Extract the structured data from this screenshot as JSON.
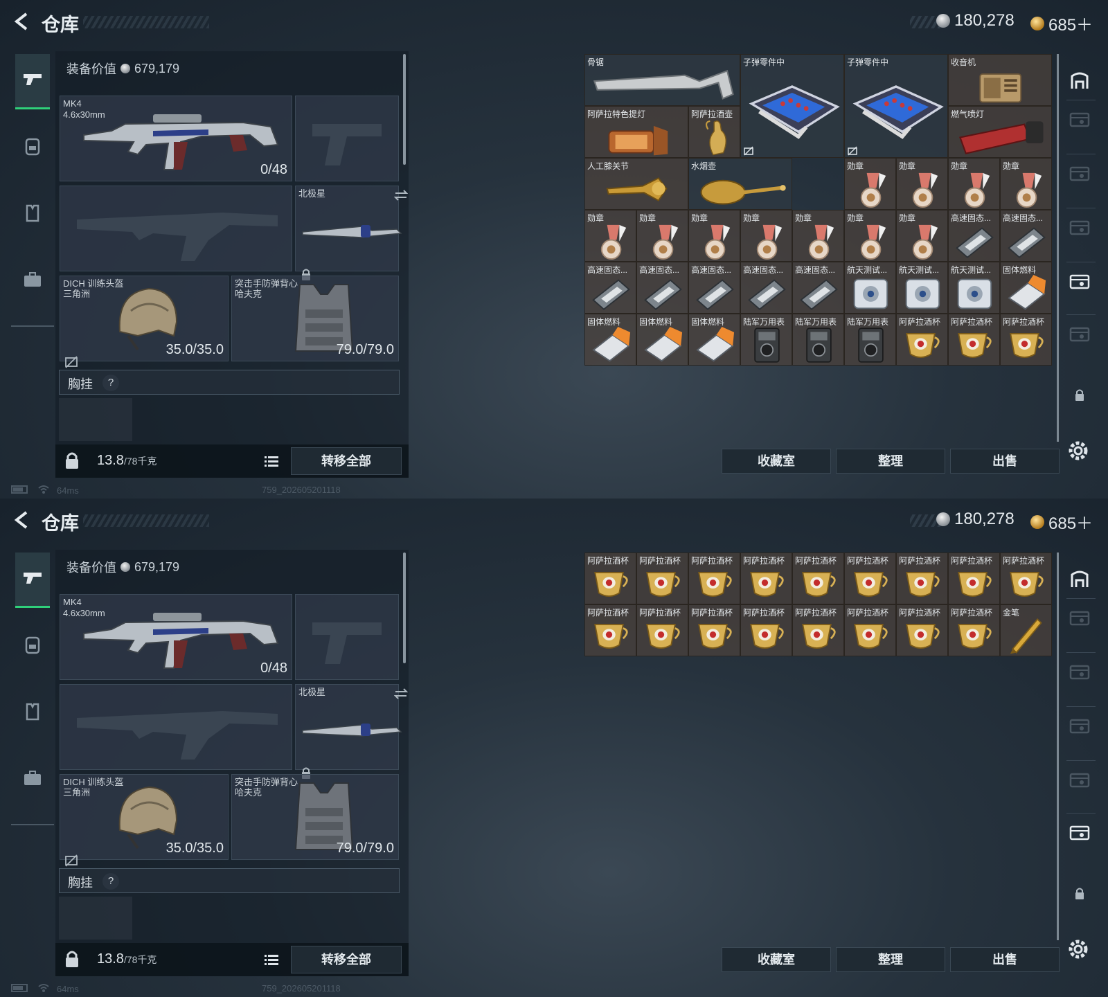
{
  "screens": [
    {
      "title": "仓库",
      "currency": {
        "silver": "180,278",
        "gold": "685＋"
      },
      "equip_value_label": "装备价值",
      "equip_value": "679,179",
      "weapon": {
        "name": "MK4",
        "ammo_type": "4.6x30mm",
        "ammo": "0/48"
      },
      "melee": {
        "name": "北极星"
      },
      "helmet": {
        "name": "DICH 训练头盔",
        "brand": "三角洲",
        "durability": "35.0/35.0"
      },
      "armor": {
        "name": "突击手防弹背心",
        "brand": "哈夫克",
        "durability": "79.0/79.0"
      },
      "chest_rig": {
        "label": "胸挂",
        "hint": "?"
      },
      "weight": {
        "current": "13.8",
        "max": "/78千克"
      },
      "transfer_all": "转移全部",
      "status": {
        "ping": "64ms",
        "build": "759_202605201118"
      },
      "actions": {
        "collection": "收藏室",
        "sort": "整理",
        "sell": "出售"
      },
      "stash": [
        {
          "label": "骨锯",
          "icon": "bone-saw-icon"
        },
        {
          "label": "子弹零件中",
          "icon": "ammo-parts-box-icon"
        },
        {
          "label": "子弹零件中",
          "icon": "ammo-parts-box-icon"
        },
        {
          "label": "收音机",
          "icon": "radio-icon"
        },
        {
          "label": "阿萨拉特色提灯",
          "icon": "lantern-icon"
        },
        {
          "label": "阿萨拉酒壶",
          "icon": "wine-pot-icon"
        },
        {
          "label": "燃气喷灯",
          "icon": "gas-torch-icon"
        },
        {
          "label": "人工膝关节",
          "icon": "knee-joint-icon"
        },
        {
          "label": "水烟壶",
          "icon": "hookah-icon"
        },
        {
          "label": "勋章",
          "icon": "medal-icon"
        },
        {
          "label": "勋章",
          "icon": "medal-icon"
        },
        {
          "label": "勋章",
          "icon": "medal-icon"
        },
        {
          "label": "勋章",
          "icon": "medal-icon"
        },
        {
          "label": "勋章",
          "icon": "medal-icon"
        },
        {
          "label": "勋章",
          "icon": "medal-icon"
        },
        {
          "label": "勋章",
          "icon": "medal-icon"
        },
        {
          "label": "勋章",
          "icon": "medal-icon"
        },
        {
          "label": "勋章",
          "icon": "medal-icon"
        },
        {
          "label": "勋章",
          "icon": "medal-icon"
        },
        {
          "label": "勋章",
          "icon": "medal-icon"
        },
        {
          "label": "高速固态...",
          "icon": "ssd-icon"
        },
        {
          "label": "高速固态...",
          "icon": "ssd-icon"
        },
        {
          "label": "高速固态...",
          "icon": "ssd-icon"
        },
        {
          "label": "高速固态...",
          "icon": "ssd-icon"
        },
        {
          "label": "高速固态...",
          "icon": "ssd-icon"
        },
        {
          "label": "高速固态...",
          "icon": "ssd-icon"
        },
        {
          "label": "高速固态...",
          "icon": "ssd-icon"
        },
        {
          "label": "航天测试...",
          "icon": "test-disk-icon"
        },
        {
          "label": "航天测试...",
          "icon": "test-disk-icon"
        },
        {
          "label": "航天测试...",
          "icon": "test-disk-icon"
        },
        {
          "label": "固体燃料",
          "icon": "solid-fuel-icon"
        },
        {
          "label": "固体燃料",
          "icon": "solid-fuel-icon"
        },
        {
          "label": "固体燃料",
          "icon": "solid-fuel-icon"
        },
        {
          "label": "固体燃料",
          "icon": "solid-fuel-icon"
        },
        {
          "label": "陆军万用表",
          "icon": "multimeter-icon"
        },
        {
          "label": "陆军万用表",
          "icon": "multimeter-icon"
        },
        {
          "label": "陆军万用表",
          "icon": "multimeter-icon"
        },
        {
          "label": "阿萨拉酒杯",
          "icon": "gold-cup-icon"
        },
        {
          "label": "阿萨拉酒杯",
          "icon": "gold-cup-icon"
        },
        {
          "label": "阿萨拉酒杯",
          "icon": "gold-cup-icon"
        }
      ]
    },
    {
      "title": "仓库",
      "currency": {
        "silver": "180,278",
        "gold": "685＋"
      },
      "equip_value_label": "装备价值",
      "equip_value": "679,179",
      "weapon": {
        "name": "MK4",
        "ammo_type": "4.6x30mm",
        "ammo": "0/48"
      },
      "melee": {
        "name": "北极星"
      },
      "helmet": {
        "name": "DICH 训练头盔",
        "brand": "三角洲",
        "durability": "35.0/35.0"
      },
      "armor": {
        "name": "突击手防弹背心",
        "brand": "哈夫克",
        "durability": "79.0/79.0"
      },
      "chest_rig": {
        "label": "胸挂",
        "hint": "?"
      },
      "weight": {
        "current": "13.8",
        "max": "/78千克"
      },
      "transfer_all": "转移全部",
      "status": {
        "ping": "64ms",
        "build": "759_202605201118"
      },
      "actions": {
        "collection": "收藏室",
        "sort": "整理",
        "sell": "出售"
      },
      "stash": [
        {
          "label": "阿萨拉酒杯",
          "icon": "gold-cup-icon"
        },
        {
          "label": "阿萨拉酒杯",
          "icon": "gold-cup-icon"
        },
        {
          "label": "阿萨拉酒杯",
          "icon": "gold-cup-icon"
        },
        {
          "label": "阿萨拉酒杯",
          "icon": "gold-cup-icon"
        },
        {
          "label": "阿萨拉酒杯",
          "icon": "gold-cup-icon"
        },
        {
          "label": "阿萨拉酒杯",
          "icon": "gold-cup-icon"
        },
        {
          "label": "阿萨拉酒杯",
          "icon": "gold-cup-icon"
        },
        {
          "label": "阿萨拉酒杯",
          "icon": "gold-cup-icon"
        },
        {
          "label": "阿萨拉酒杯",
          "icon": "gold-cup-icon"
        },
        {
          "label": "阿萨拉酒杯",
          "icon": "gold-cup-icon"
        },
        {
          "label": "阿萨拉酒杯",
          "icon": "gold-cup-icon"
        },
        {
          "label": "阿萨拉酒杯",
          "icon": "gold-cup-icon"
        },
        {
          "label": "阿萨拉酒杯",
          "icon": "gold-cup-icon"
        },
        {
          "label": "阿萨拉酒杯",
          "icon": "gold-cup-icon"
        },
        {
          "label": "阿萨拉酒杯",
          "icon": "gold-cup-icon"
        },
        {
          "label": "阿萨拉酒杯",
          "icon": "gold-cup-icon"
        },
        {
          "label": "阿萨拉酒杯",
          "icon": "gold-cup-icon"
        },
        {
          "label": "金笔",
          "icon": "gold-pen-icon"
        }
      ]
    }
  ],
  "colors": {
    "accent_green": "#2fd07a",
    "gold_cell": "#4b413c",
    "blue_cell": "#3c4662"
  }
}
